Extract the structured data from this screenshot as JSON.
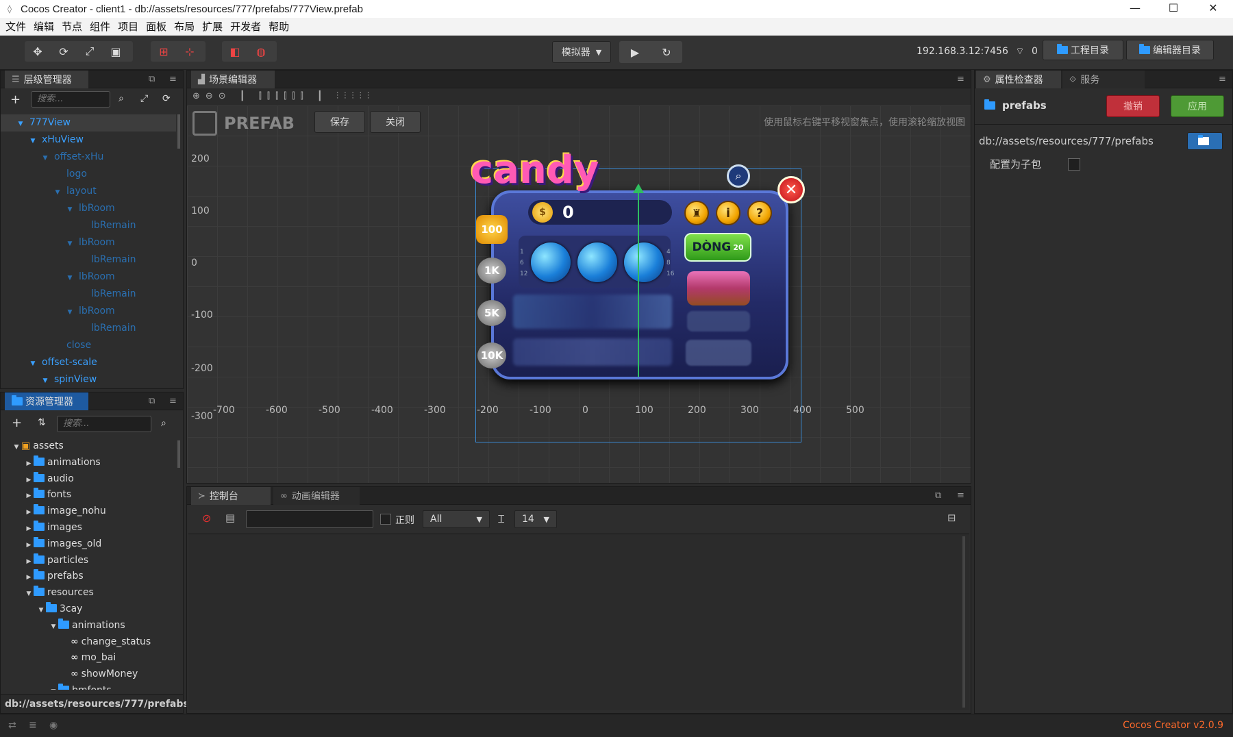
{
  "window": {
    "title": "Cocos Creator - client1 - db://assets/resources/777/prefabs/777View.prefab",
    "minimize": "—",
    "maximize": "☐",
    "close": "✕"
  },
  "menu": [
    "文件",
    "编辑",
    "节点",
    "组件",
    "项目",
    "面板",
    "布局",
    "扩展",
    "开发者",
    "帮助"
  ],
  "toolbar": {
    "preview_mode": "模拟器",
    "play": "▶",
    "refresh": "↻",
    "ip": "192.168.3.12:7456",
    "connections": "0",
    "project_dir": "工程目录",
    "editor_dir": "编辑器目录"
  },
  "hierarchy": {
    "tab": "层级管理器",
    "search_placeholder": "搜索...",
    "nodes": [
      {
        "label": "777View",
        "indent": 0,
        "arrow": "▼",
        "selected": true,
        "color": "#3aa0ff"
      },
      {
        "label": "xHuView",
        "indent": 1,
        "arrow": "▼",
        "color": "#3aa0ff"
      },
      {
        "label": "offset-xHu",
        "indent": 2,
        "arrow": "▼",
        "color": "#2a6fb0"
      },
      {
        "label": "logo",
        "indent": 3,
        "arrow": "",
        "color": "#2a6fb0"
      },
      {
        "label": "layout",
        "indent": 3,
        "arrow": "▼",
        "color": "#2a6fb0"
      },
      {
        "label": "lbRoom",
        "indent": 4,
        "arrow": "▼",
        "color": "#2a6fb0"
      },
      {
        "label": "lbRemain",
        "indent": 5,
        "arrow": "",
        "color": "#2a6fb0"
      },
      {
        "label": "lbRoom",
        "indent": 4,
        "arrow": "▼",
        "color": "#2a6fb0"
      },
      {
        "label": "lbRemain",
        "indent": 5,
        "arrow": "",
        "color": "#2a6fb0"
      },
      {
        "label": "lbRoom",
        "indent": 4,
        "arrow": "▼",
        "color": "#2a6fb0"
      },
      {
        "label": "lbRemain",
        "indent": 5,
        "arrow": "",
        "color": "#2a6fb0"
      },
      {
        "label": "lbRoom",
        "indent": 4,
        "arrow": "▼",
        "color": "#2a6fb0"
      },
      {
        "label": "lbRemain",
        "indent": 5,
        "arrow": "",
        "color": "#2a6fb0"
      },
      {
        "label": "close",
        "indent": 3,
        "arrow": "",
        "color": "#2a6fb0"
      },
      {
        "label": "offset-scale",
        "indent": 1,
        "arrow": "▼",
        "color": "#3aa0ff"
      },
      {
        "label": "spinView",
        "indent": 2,
        "arrow": "▼",
        "color": "#3aa0ff"
      }
    ]
  },
  "assets": {
    "tab": "资源管理器",
    "search_placeholder": "搜索...",
    "items": [
      {
        "label": "assets",
        "indent": 0,
        "arrow": "▼",
        "type": "db"
      },
      {
        "label": "animations",
        "indent": 1,
        "arrow": "▶",
        "type": "folder"
      },
      {
        "label": "audio",
        "indent": 1,
        "arrow": "▶",
        "type": "folder"
      },
      {
        "label": "fonts",
        "indent": 1,
        "arrow": "▶",
        "type": "folder"
      },
      {
        "label": "image_nohu",
        "indent": 1,
        "arrow": "▶",
        "type": "folder"
      },
      {
        "label": "images",
        "indent": 1,
        "arrow": "▶",
        "type": "folder"
      },
      {
        "label": "images_old",
        "indent": 1,
        "arrow": "▶",
        "type": "folder"
      },
      {
        "label": "particles",
        "indent": 1,
        "arrow": "▶",
        "type": "folder"
      },
      {
        "label": "prefabs",
        "indent": 1,
        "arrow": "▶",
        "type": "folder"
      },
      {
        "label": "resources",
        "indent": 1,
        "arrow": "▼",
        "type": "folder"
      },
      {
        "label": "3cay",
        "indent": 2,
        "arrow": "▼",
        "type": "folder"
      },
      {
        "label": "animations",
        "indent": 3,
        "arrow": "▼",
        "type": "folder"
      },
      {
        "label": "change_status",
        "indent": 4,
        "arrow": "",
        "type": "anim"
      },
      {
        "label": "mo_bai",
        "indent": 4,
        "arrow": "",
        "type": "anim"
      },
      {
        "label": "showMoney",
        "indent": 4,
        "arrow": "",
        "type": "anim"
      },
      {
        "label": "bmfonts",
        "indent": 3,
        "arrow": "▼",
        "type": "folder"
      }
    ],
    "path": "db://assets/resources/777/prefabs"
  },
  "scene": {
    "tab": "场景编辑器",
    "prefab_label": "PREFAB",
    "save": "保存",
    "close": "关闭",
    "hint": "使用鼠标右键平移视窗焦点，使用滚轮缩放视图",
    "y_labels": [
      "200",
      "100",
      "0",
      "-100",
      "-200",
      "-300"
    ],
    "x_labels": [
      "-700",
      "-600",
      "-500",
      "-400",
      "-300",
      "-200",
      "-100",
      "0",
      "100",
      "200",
      "300",
      "400",
      "500"
    ],
    "game": {
      "logo": "candy",
      "score": "0",
      "bets": [
        "100",
        "1K",
        "5K",
        "10K"
      ],
      "line_button": "DÒNG",
      "line_count": "20",
      "left_numbers": [
        "1",
        "6",
        "12"
      ],
      "right_numbers": [
        "4",
        "8",
        "16"
      ]
    }
  },
  "inspector": {
    "tab": "属性检查器",
    "tab2": "服务",
    "name": "prefabs",
    "revert": "撤销",
    "apply": "应用",
    "path": "db://assets/resources/777/prefabs",
    "subpackage_label": "配置为子包"
  },
  "console": {
    "tab": "控制台",
    "tab2": "动画编辑器",
    "regex_label": "正则",
    "level": "All",
    "font_size": "14"
  },
  "status": {
    "version": "Cocos Creator v2.0.9"
  },
  "colors": {
    "accent": "#3aa0ff",
    "revert": "#c0303a",
    "apply": "#4e9a35",
    "version_text": "#ff6a2b"
  }
}
